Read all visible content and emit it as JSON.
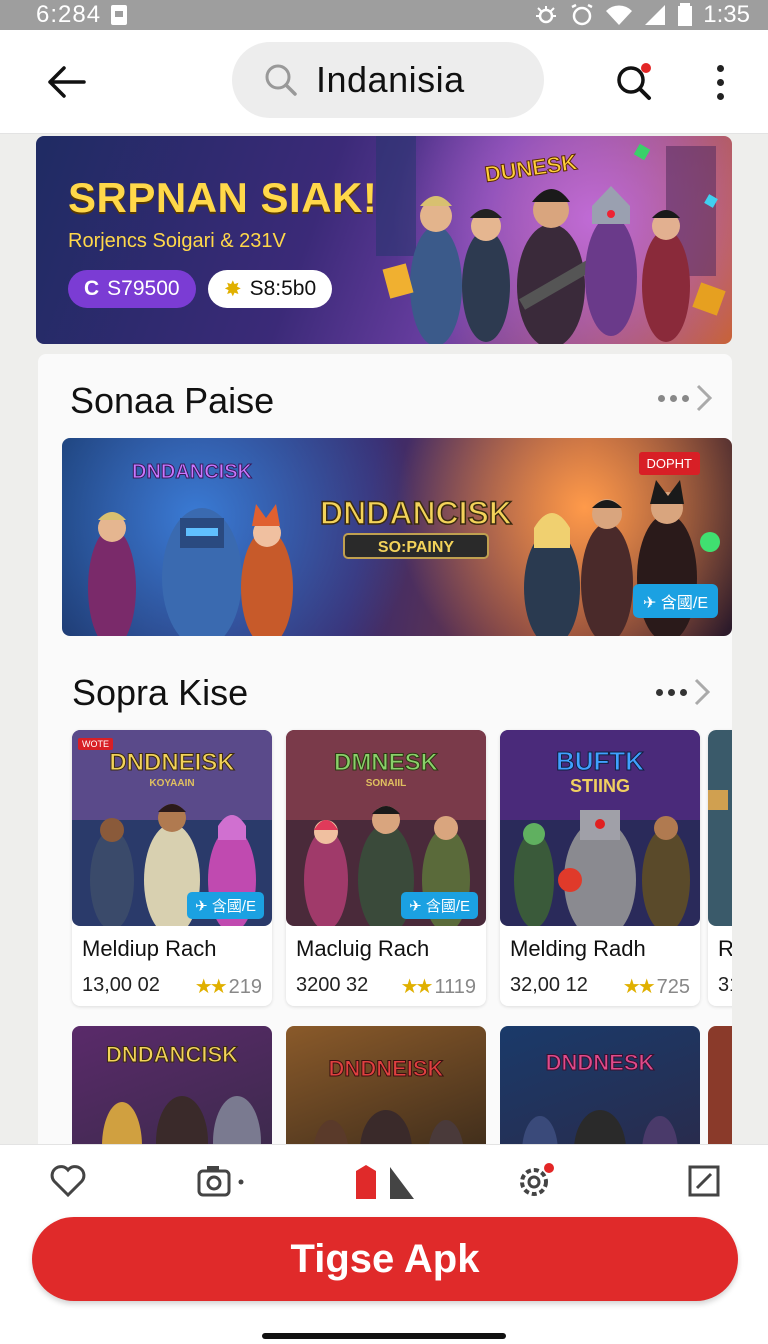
{
  "status_bar": {
    "left_time": "6:284",
    "right_time": "1:35"
  },
  "app_bar": {
    "search_query": "Indanisia"
  },
  "hero": {
    "title": "SRPNAN SIAK!",
    "subtitle": "Rorjencs Soigari & 231V",
    "chip_purple": "S79500",
    "chip_white": "S8:5b0",
    "badge_text": "DUNESK",
    "colors": {
      "title": "#ffd84a",
      "chip_purple": "#7b3cd4"
    }
  },
  "section1": {
    "title": "Sonaa Paise",
    "feature": {
      "logo_title": "DNDANCISK",
      "logo_sub": "SO:PAINY",
      "corner_badge": "DOPHT",
      "cta": "✈ 含國/E"
    }
  },
  "section2": {
    "title": "Sopra Kise",
    "tiles": [
      {
        "logo": "DNDNEISK",
        "logo_sub": "KOYAAIN",
        "name": "Meldiup Rach",
        "price": "13,00 02",
        "rating": "219",
        "tag": "✈ 含國/E",
        "corner": "WOTE"
      },
      {
        "logo": "DMNESK",
        "logo_sub": "SONAIIL",
        "name": "Macluig Rach",
        "price": "3200 32",
        "rating": "1119",
        "tag": "✈ 含國/E"
      },
      {
        "logo": "BUFTK",
        "logo_sub": "STIING",
        "name": "Melding Radh",
        "price": "32,00 12",
        "rating": "725"
      },
      {
        "name": "R",
        "price": "31"
      }
    ],
    "row2_logos": [
      "DNDANCISK",
      "DNDNEISK",
      "DNDNESK"
    ]
  },
  "bottom_nav": {
    "items": [
      "favorites-icon",
      "camera-icon",
      "home-icon",
      "settings-icon",
      "edit-icon"
    ],
    "accent": "#e02a2a"
  },
  "download_button": {
    "label": "Tigse Apk"
  }
}
